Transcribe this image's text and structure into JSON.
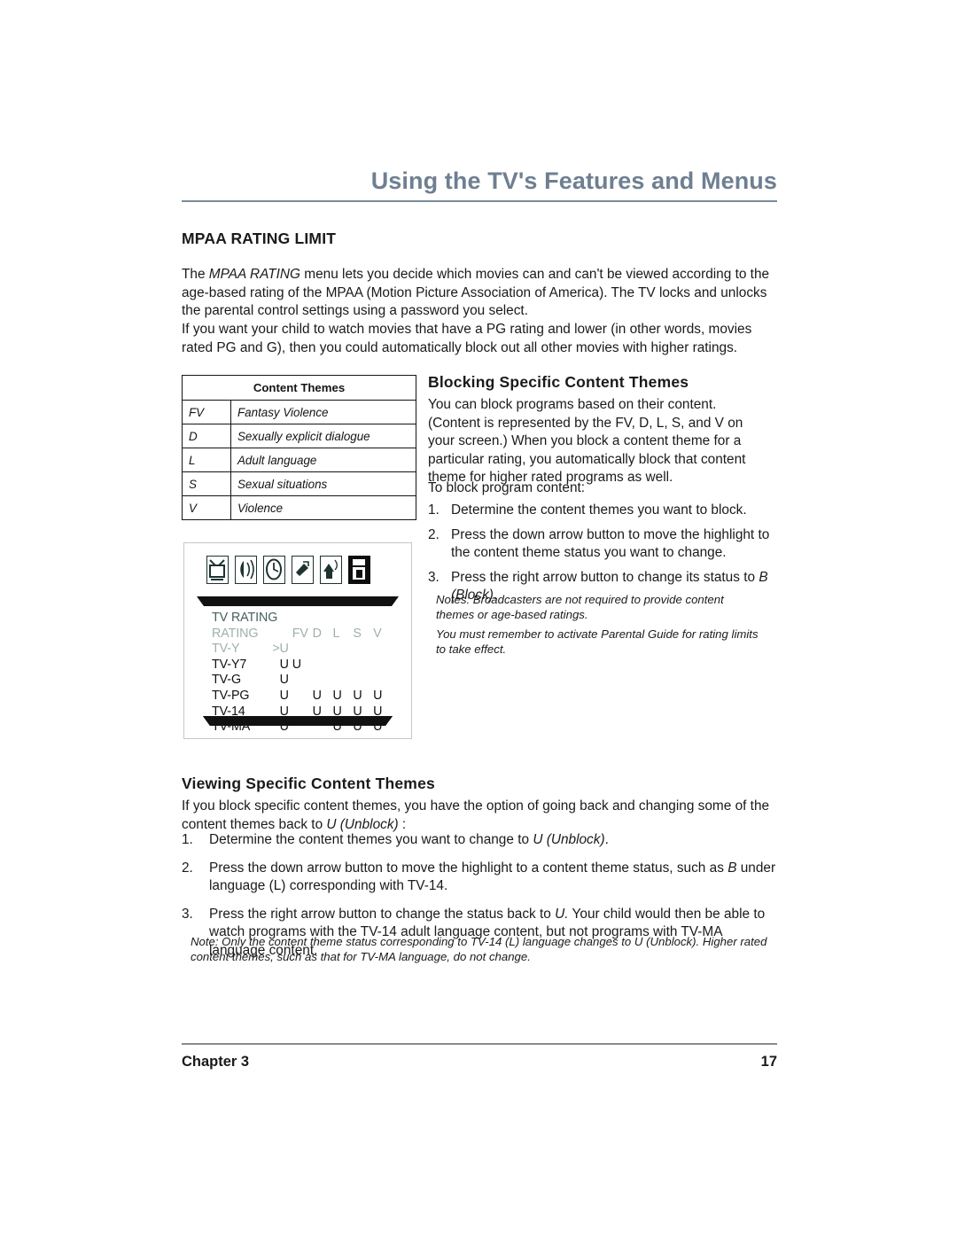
{
  "header": {
    "title": "Using the TV's Features and Menus"
  },
  "section": {
    "heading": "MPAA RATING LIMIT",
    "para1_a": "The ",
    "para1_em": "MPAA RATING",
    "para1_b": " menu lets you decide which movies can and can't be viewed according to the age-based rating of the MPAA (Motion Picture Association of America). The TV locks and unlocks the parental control settings using a password you select.",
    "para2": "If you want your child to watch movies that have a PG rating and lower (in other words, movies rated PG and G), then you could automatically block out all other movies with higher ratings."
  },
  "content_themes_table": {
    "header": "Content Themes",
    "rows": [
      {
        "code": "FV",
        "description": "Fantasy Violence"
      },
      {
        "code": "D",
        "description": "Sexually explicit dialogue"
      },
      {
        "code": "L",
        "description": "Adult language"
      },
      {
        "code": "S",
        "description": "Sexual situations"
      },
      {
        "code": "V",
        "description": "Violence"
      }
    ]
  },
  "tv_screen": {
    "icons": [
      "picture-icon",
      "audio-icon",
      "time-icon",
      "channel-icon",
      "setup-icon",
      "parental-lock-icon"
    ],
    "selected_icon": "parental-lock-icon",
    "menu_title": "TV RATING",
    "column_headers": [
      "RATING",
      "",
      "FV",
      "D",
      "L",
      "S",
      "V"
    ],
    "rows": [
      {
        "label": "TV-Y",
        "status": ">U",
        "fv": "",
        "d": "",
        "l": "",
        "s": "",
        "v": "",
        "dim": true
      },
      {
        "label": "TV-Y7",
        "status": "U",
        "fv": "U",
        "d": "",
        "l": "",
        "s": "",
        "v": "",
        "dim": false
      },
      {
        "label": "TV-G",
        "status": "U",
        "fv": "",
        "d": "",
        "l": "",
        "s": "",
        "v": "",
        "dim": false
      },
      {
        "label": "TV-PG",
        "status": "U",
        "fv": "",
        "d": "U",
        "l": "U",
        "s": "U",
        "v": "U",
        "dim": false
      },
      {
        "label": "TV-14",
        "status": "U",
        "fv": "",
        "d": "U",
        "l": "U",
        "s": "U",
        "v": "U",
        "dim": false
      },
      {
        "label": "TV-MA",
        "status": "U",
        "fv": "",
        "d": "",
        "l": "U",
        "s": "U",
        "v": "U",
        "dim": false
      }
    ],
    "colors": {
      "title": "#44605e",
      "dim": "#9fb0ae",
      "active": "#111111",
      "bar": "#111111"
    }
  },
  "blocking": {
    "heading": "Blocking Specific Content Themes",
    "para1": "You can block programs based on their content. (Content is represented by the FV, D, L, S, and V on your screen.) When you block a content theme for a particular rating, you automatically block that content theme for higher rated programs as well.",
    "para2": "To block program content:",
    "steps": [
      {
        "num": "1.",
        "text": "Determine the content themes you want to block."
      },
      {
        "num": "2.",
        "text": "Press the down arrow button to move the highlight to the content theme status you want to change."
      },
      {
        "num": "3.",
        "text_a": "Press the right arrow button to change its status to ",
        "text_em": "B (Block)",
        "text_b": "."
      }
    ],
    "note1": "Notes: Broadcasters are not required to provide content themes or age-based ratings.",
    "note2": "You must remember to activate Parental Guide for rating limits to take effect."
  },
  "viewing": {
    "heading": "Viewing Specific Content Themes",
    "para1_a": "If you block specific content themes, you have the option of going back and changing some of the content themes back to ",
    "para1_em": "U (Unblock)",
    "para1_b": " :",
    "steps": [
      {
        "num": "1.",
        "text_a": "Determine the content themes you want to change to ",
        "text_em": "U (Unblock)",
        "text_b": "."
      },
      {
        "num": "2.",
        "text_a": "Press the down arrow button to move the highlight to a content theme status, such as ",
        "text_em": "B",
        "text_b": " under language (L) corresponding with TV-14."
      },
      {
        "num": "3.",
        "text_a": "Press the right arrow button to change the status back to ",
        "text_em": "U.",
        "text_b": "  Your child would then be able to watch programs with the TV-14 adult language content, but not programs with TV-MA language content."
      }
    ],
    "note": "Note:  Only the content theme status corresponding to TV-14  (L) language changes to U (Unblock). Higher rated content themes, such as that for TV-MA language, do not change."
  },
  "footer": {
    "chapter": "Chapter 3",
    "page_number": "17"
  },
  "theme": {
    "header_color": "#6e7f91",
    "rule_color": "#7b8b9c",
    "text_color": "#1a1a1a"
  }
}
